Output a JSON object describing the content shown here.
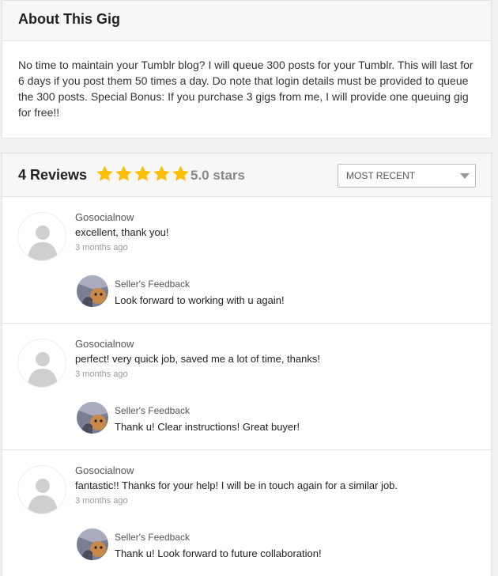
{
  "about": {
    "title": "About This Gig",
    "description": "No time to maintain your Tumblr blog? I will queue 300 posts for your Tumblr. This will last for 6 days if you post them 50 times a day. Do note that login details must be provided to queue the 300 posts. Special Bonus: If you purchase 3 gigs from me, I will provide one queuing gig for free!!"
  },
  "reviews": {
    "count_label": "4 Reviews",
    "rating_label": "5.0 stars",
    "rating_value": 5,
    "star_color": "#ffbf00",
    "sort": {
      "selected": "MOST RECENT"
    },
    "items": [
      {
        "user": "Gosocialnow",
        "text": "excellent, thank you!",
        "time": "3 months ago",
        "feedback_label": "Seller's Feedback",
        "feedback_text": "Look forward to working with u again!"
      },
      {
        "user": "Gosocialnow",
        "text": "perfect! very quick job, saved me a lot of time, thanks!",
        "time": "3 months ago",
        "feedback_label": "Seller's Feedback",
        "feedback_text": "Thank u! Clear instructions! Great buyer!"
      },
      {
        "user": "Gosocialnow",
        "text": "fantastic!! Thanks for your help! I will be in touch again for a similar job.",
        "time": "3 months ago",
        "feedback_label": "Seller's Feedback",
        "feedback_text": "Thank u! Look forward to future collaboration!"
      }
    ]
  }
}
